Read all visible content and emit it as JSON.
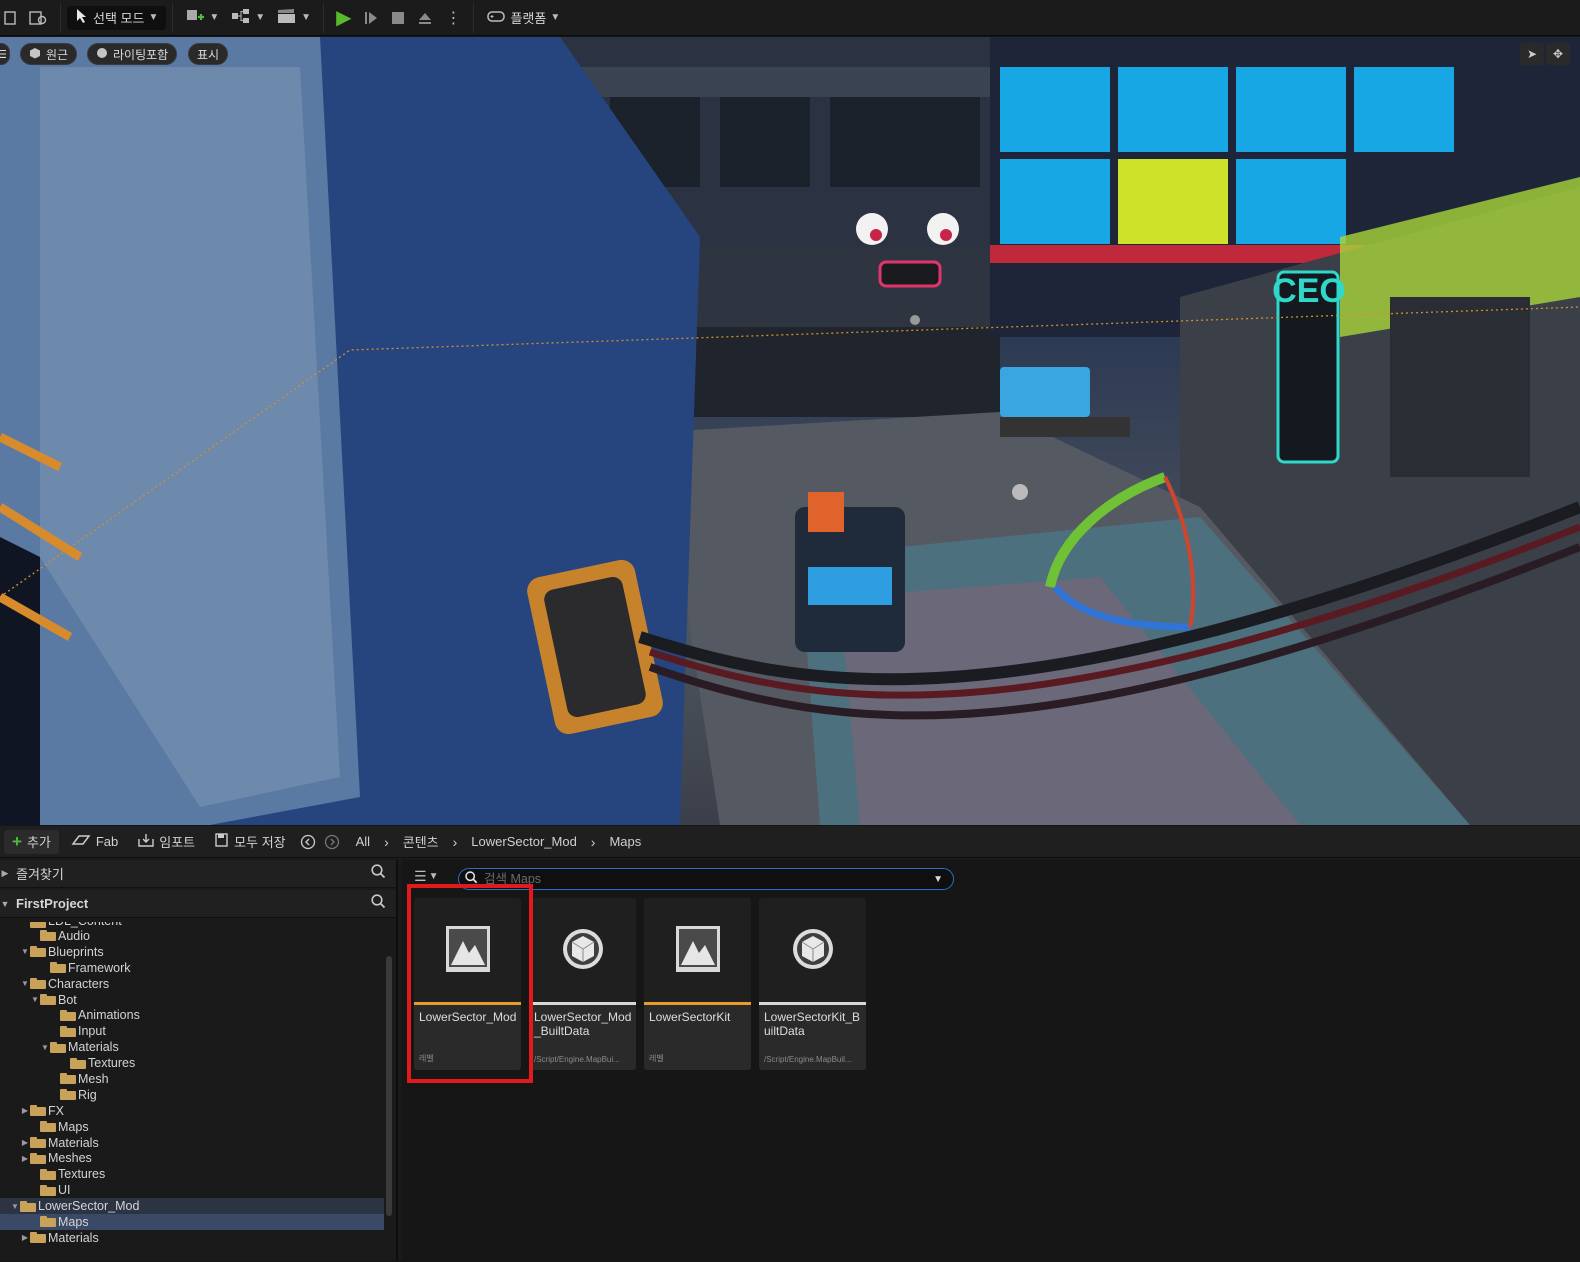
{
  "toolbar": {
    "mode_label": "선택 모드",
    "platform_label": "플랫폼"
  },
  "viewport": {
    "perspective_label": "원근",
    "lighting_label": "라이팅포함",
    "show_label": "표시",
    "sign_text": "CEO"
  },
  "content_browser": {
    "add_label": "추가",
    "fab_label": "Fab",
    "import_label": "임포트",
    "save_all_label": "모두 저장",
    "breadcrumb": [
      "All",
      "콘텐츠",
      "LowerSector_Mod",
      "Maps"
    ],
    "favorites_label": "즐겨찾기",
    "project_label": "FirstProject",
    "search_placeholder": "검색 Maps",
    "tree": [
      {
        "label": "LDL_Content",
        "depth": 2,
        "twist": "",
        "state": "cut"
      },
      {
        "label": "Audio",
        "depth": 3,
        "twist": "",
        "state": ""
      },
      {
        "label": "Blueprints",
        "depth": 2,
        "twist": "▼",
        "state": ""
      },
      {
        "label": "Framework",
        "depth": 4,
        "twist": "",
        "state": ""
      },
      {
        "label": "Characters",
        "depth": 2,
        "twist": "▼",
        "state": ""
      },
      {
        "label": "Bot",
        "depth": 3,
        "twist": "▼",
        "state": ""
      },
      {
        "label": "Animations",
        "depth": 5,
        "twist": "",
        "state": ""
      },
      {
        "label": "Input",
        "depth": 5,
        "twist": "",
        "state": ""
      },
      {
        "label": "Materials",
        "depth": 4,
        "twist": "▼",
        "state": ""
      },
      {
        "label": "Textures",
        "depth": 6,
        "twist": "",
        "state": ""
      },
      {
        "label": "Mesh",
        "depth": 5,
        "twist": "",
        "state": ""
      },
      {
        "label": "Rig",
        "depth": 5,
        "twist": "",
        "state": ""
      },
      {
        "label": "FX",
        "depth": 2,
        "twist": "▶",
        "state": ""
      },
      {
        "label": "Maps",
        "depth": 3,
        "twist": "",
        "state": ""
      },
      {
        "label": "Materials",
        "depth": 2,
        "twist": "▶",
        "state": ""
      },
      {
        "label": "Meshes",
        "depth": 2,
        "twist": "▶",
        "state": ""
      },
      {
        "label": "Textures",
        "depth": 3,
        "twist": "",
        "state": ""
      },
      {
        "label": "UI",
        "depth": 3,
        "twist": "",
        "state": ""
      },
      {
        "label": "LowerSector_Mod",
        "depth": 1,
        "twist": "▼",
        "state": "parent-sel"
      },
      {
        "label": "Maps",
        "depth": 3,
        "twist": "",
        "state": "selected"
      },
      {
        "label": "Materials",
        "depth": 2,
        "twist": "▶",
        "state": ""
      }
    ],
    "assets": [
      {
        "name": "LowerSector_Mod",
        "type": "레벨",
        "icon": "level-icon",
        "bar_color": "#e79b2c"
      },
      {
        "name": "LowerSector_Mod_BuiltData",
        "type": "/Script/Engine.MapBui...",
        "icon": "mapbuilddata-icon",
        "bar_color": "#d8d8d8"
      },
      {
        "name": "LowerSectorKit",
        "type": "레벨",
        "icon": "level-icon",
        "bar_color": "#e79b2c"
      },
      {
        "name": "LowerSectorKit_BuiltData",
        "type": "/Script/Engine.MapBuil...",
        "icon": "mapbuilddata-icon",
        "bar_color": "#d8d8d8"
      }
    ],
    "highlight_color": "#e21a1a"
  }
}
